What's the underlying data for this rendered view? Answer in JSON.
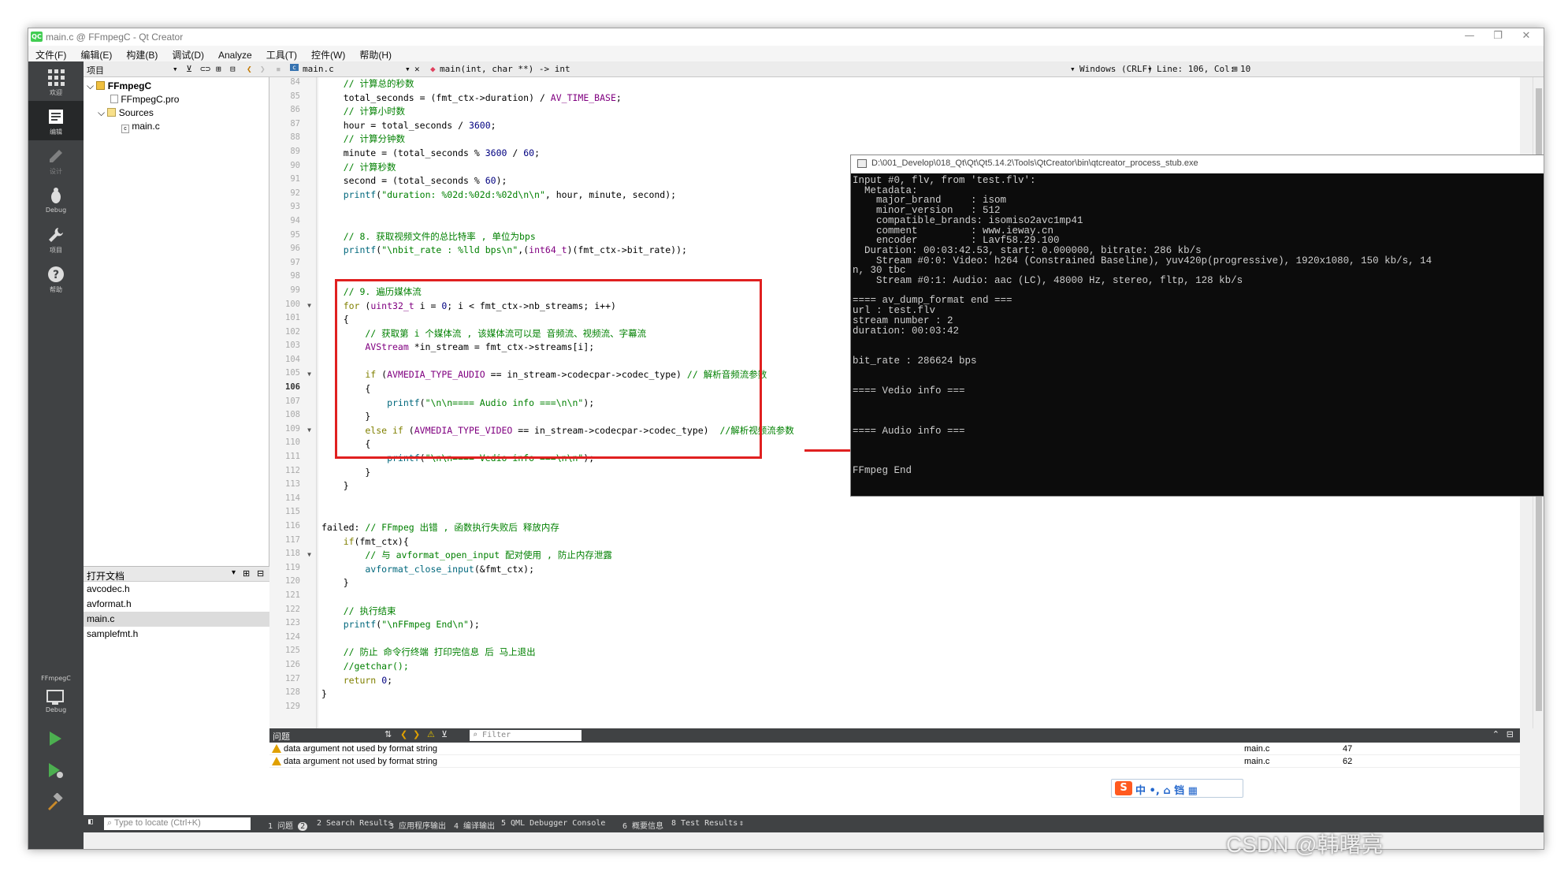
{
  "window": {
    "title": "main.c @ FFmpegC - Qt Creator",
    "logo": "QC"
  },
  "menu": [
    "文件(F)",
    "编辑(E)",
    "构建(B)",
    "调试(D)",
    "Analyze",
    "工具(T)",
    "控件(W)",
    "帮助(H)"
  ],
  "modes": [
    {
      "label": "欢迎",
      "icon": "grid-icon"
    },
    {
      "label": "编辑",
      "icon": "edit-icon"
    },
    {
      "label": "设计",
      "icon": "pencil-icon"
    },
    {
      "label": "Debug",
      "icon": "bug-icon"
    },
    {
      "label": "项目",
      "icon": "wrench-icon"
    },
    {
      "label": "帮助",
      "icon": "help-icon"
    }
  ],
  "target": {
    "project": "FFmpegC",
    "mode": "Debug"
  },
  "toolbar": {
    "projects_label": "项目",
    "file_combo": "main.c",
    "symbol": "main(int, char **) -> int",
    "line_ending": "Windows (CRLF)",
    "cursor": "Line: 106, Col: 10"
  },
  "tree": {
    "root": "FFmpegC",
    "pro": "FFmpegC.pro",
    "sources": "Sources",
    "main": "main.c"
  },
  "opendocs": {
    "title": "打开文档",
    "files": [
      "avcodec.h",
      "avformat.h",
      "main.c",
      "samplefmt.h"
    ],
    "selected": "main.c"
  },
  "code": {
    "first_line": 84,
    "current_line": 106,
    "lines": [
      [
        [
          "c",
          "    // 计算总的秒数"
        ]
      ],
      [
        [
          "",
          "    total_seconds = (fmt_ctx->duration) / "
        ],
        [
          "t",
          "AV_TIME_BASE"
        ],
        [
          "",
          ";"
        ]
      ],
      [
        [
          "c",
          "    // 计算小时数"
        ]
      ],
      [
        [
          "",
          "    hour = total_seconds / "
        ],
        [
          "n",
          "3600"
        ],
        [
          "",
          ";"
        ]
      ],
      [
        [
          "c",
          "    // 计算分钟数"
        ]
      ],
      [
        [
          "",
          "    minute = (total_seconds % "
        ],
        [
          "n",
          "3600"
        ],
        [
          "",
          " / "
        ],
        [
          "n",
          "60"
        ],
        [
          "",
          ";"
        ]
      ],
      [
        [
          "c",
          "    // 计算秒数"
        ]
      ],
      [
        [
          "",
          "    second = (total_seconds % "
        ],
        [
          "n",
          "60"
        ],
        [
          "",
          ");"
        ]
      ],
      [
        [
          "f",
          "    printf"
        ],
        [
          "",
          "("
        ],
        [
          "s",
          "\"duration: %02d:%02d:%02d\\n\\n\""
        ],
        [
          "",
          ", hour, minute, second);"
        ]
      ],
      [
        [
          "",
          ""
        ]
      ],
      [
        [
          "",
          ""
        ]
      ],
      [
        [
          "c",
          "    // 8. 获取视频文件的总比特率 , 单位为bps"
        ]
      ],
      [
        [
          "f",
          "    printf"
        ],
        [
          "",
          "("
        ],
        [
          "s",
          "\"\\nbit_rate : %lld bps\\n\""
        ],
        [
          "",
          ",("
        ],
        [
          "t",
          "int64_t"
        ],
        [
          "",
          ")(fmt_ctx->bit_rate));"
        ]
      ],
      [
        [
          "",
          ""
        ]
      ],
      [
        [
          "",
          ""
        ]
      ],
      [
        [
          "c",
          "    // 9. 遍历媒体流"
        ]
      ],
      [
        [
          "k",
          "    for"
        ],
        [
          "",
          " ("
        ],
        [
          "t",
          "uint32_t"
        ],
        [
          "",
          " i = "
        ],
        [
          "n",
          "0"
        ],
        [
          "",
          "; i < fmt_ctx->nb_streams; i++)"
        ]
      ],
      [
        [
          "",
          "    {"
        ]
      ],
      [
        [
          "c",
          "        // 获取第 i 个媒体流 , 该媒体流可以是 音频流、视频流、字幕流"
        ]
      ],
      [
        [
          "t",
          "        AVStream"
        ],
        [
          "",
          " *in_stream = fmt_ctx->streams[i];"
        ]
      ],
      [
        [
          "",
          ""
        ]
      ],
      [
        [
          "k",
          "        if"
        ],
        [
          "",
          " ("
        ],
        [
          "t",
          "AVMEDIA_TYPE_AUDIO"
        ],
        [
          "",
          " == in_stream->codecpar->codec_type) "
        ],
        [
          "c",
          "// 解析音频流参数"
        ]
      ],
      [
        [
          "",
          "        {"
        ]
      ],
      [
        [
          "f",
          "            printf"
        ],
        [
          "",
          "("
        ],
        [
          "s",
          "\"\\n\\n==== Audio info ===\\n\\n\""
        ],
        [
          "",
          ");"
        ]
      ],
      [
        [
          "",
          "        }"
        ]
      ],
      [
        [
          "k",
          "        else if"
        ],
        [
          "",
          " ("
        ],
        [
          "t",
          "AVMEDIA_TYPE_VIDEO"
        ],
        [
          "",
          " == in_stream->codecpar->codec_type)  "
        ],
        [
          "c",
          "//解析视频流参数"
        ]
      ],
      [
        [
          "",
          "        {"
        ]
      ],
      [
        [
          "f",
          "            printf"
        ],
        [
          "",
          "("
        ],
        [
          "s",
          "\"\\n\\n==== Vedio info ===\\n\\n\""
        ],
        [
          "",
          ");"
        ]
      ],
      [
        [
          "",
          "        }"
        ]
      ],
      [
        [
          "",
          "    }"
        ]
      ],
      [
        [
          "",
          ""
        ]
      ],
      [
        [
          "",
          ""
        ]
      ],
      [
        [
          "",
          "failed: "
        ],
        [
          "c",
          "// FFmpeg 出错 , 函数执行失败后 释放内存"
        ]
      ],
      [
        [
          "k",
          "    if"
        ],
        [
          "",
          "(fmt_ctx){"
        ]
      ],
      [
        [
          "c",
          "        // 与 avformat_open_input 配对使用 , 防止内存泄露"
        ]
      ],
      [
        [
          "f",
          "        avformat_close_input"
        ],
        [
          "",
          "(&fmt_ctx);"
        ]
      ],
      [
        [
          "",
          "    }"
        ]
      ],
      [
        [
          "",
          ""
        ]
      ],
      [
        [
          "c",
          "    // 执行结束"
        ]
      ],
      [
        [
          "f",
          "    printf"
        ],
        [
          "",
          "("
        ],
        [
          "s",
          "\"\\nFFmpeg End\\n\""
        ],
        [
          "",
          ");"
        ]
      ],
      [
        [
          "",
          ""
        ]
      ],
      [
        [
          "c",
          "    // 防止 命令行终端 打印完信息 后 马上退出"
        ]
      ],
      [
        [
          "c",
          "    //getchar();"
        ]
      ],
      [
        [
          "k",
          "    return"
        ],
        [
          "",
          " "
        ],
        [
          "n",
          "0"
        ],
        [
          "",
          ";"
        ]
      ],
      [
        [
          "",
          "}"
        ]
      ],
      [
        [
          "",
          ""
        ]
      ]
    ],
    "folds": [
      100,
      105,
      109,
      118
    ]
  },
  "console": {
    "title": "D:\\001_Develop\\018_Qt\\Qt\\Qt5.14.2\\Tools\\QtCreator\\bin\\qtcreator_process_stub.exe",
    "text": "Input #0, flv, from 'test.flv':\n  Metadata:\n    major_brand     : isom\n    minor_version   : 512\n    compatible_brands: isomiso2avc1mp41\n    comment         : www.ieway.cn\n    encoder         : Lavf58.29.100\n  Duration: 00:03:42.53, start: 0.000000, bitrate: 286 kb/s\n    Stream #0:0: Video: h264 (Constrained Baseline), yuv420p(progressive), 1920x1080, 150 kb/s, 14\nn, 30 tbc\n    Stream #0:1: Audio: aac (LC), 48000 Hz, stereo, fltp, 128 kb/s\n\n==== av_dump_format end ===\nurl : test.flv\nstream number : 2\nduration: 00:03:42\n\n\nbit_rate : 286624 bps\n\n\n==== Vedio info ===\n\n\n\n==== Audio info ===\n\n\n\nFFmpeg End"
  },
  "issues": {
    "title": "问题",
    "filter": "Filter",
    "rows": [
      {
        "text": "data argument not used by format string",
        "file": "main.c",
        "line": "47"
      },
      {
        "text": "data argument not used by format string",
        "file": "main.c",
        "line": "62"
      }
    ]
  },
  "statusbar": {
    "locator": "Type to locate (Ctrl+K)",
    "panes": [
      "1 问题",
      "2 Search Results",
      "3 应用程序输出",
      "4 编译输出",
      "5 QML Debugger Console",
      "6 概要信息",
      "8 Test Results"
    ],
    "issue_count": "2"
  },
  "ime": {
    "text": "中 •, ⌂ 铛 ▦",
    "logo": "S"
  },
  "watermark": "CSDN @韩曙亮",
  "colors": {
    "modebar": "#404244",
    "highlight": "#e02020",
    "console_bg": "#0c0c0c"
  }
}
